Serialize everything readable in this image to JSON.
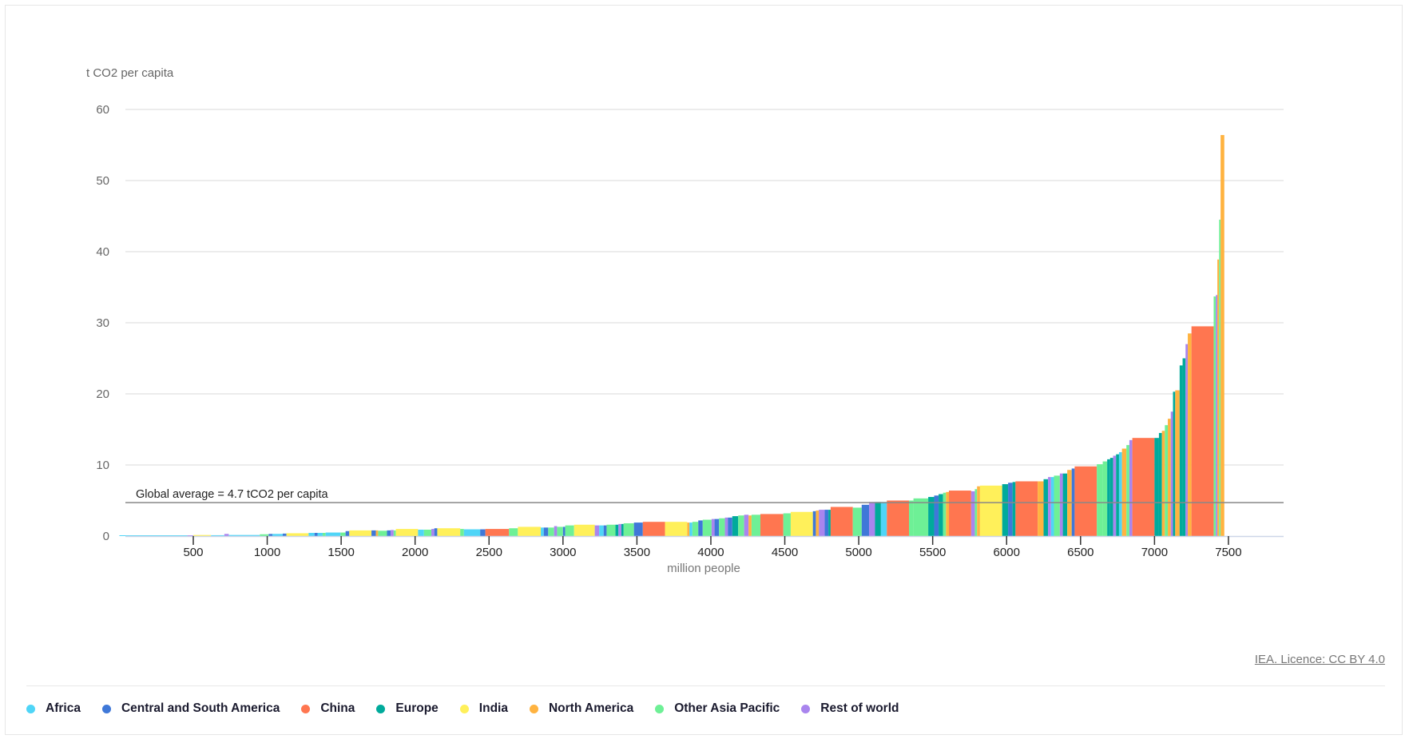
{
  "chart_data": {
    "type": "bar",
    "subtype": "variable-width (Marimekko) bar chart sorted by value",
    "title": "",
    "ylabel": "t CO2 per capita",
    "xlabel": "million people",
    "ylim": [
      0,
      60
    ],
    "xlim": [
      0,
      7830
    ],
    "yticks": [
      "0",
      "10",
      "20",
      "30",
      "40",
      "50",
      "60"
    ],
    "xticks": [
      "500",
      "1000",
      "1500",
      "2000",
      "2500",
      "3000",
      "3500",
      "4000",
      "4500",
      "5000",
      "5500",
      "6000",
      "6500",
      "7000",
      "7500"
    ],
    "grid": true,
    "reference_line": {
      "value": 4.7,
      "label": "Global average = 4.7 tCO2 per capita"
    },
    "legend_position": "bottom-left",
    "regions": [
      {
        "name": "Africa",
        "color": "#4fd5f7"
      },
      {
        "name": "Central and South America",
        "color": "#3f78d8"
      },
      {
        "name": "China",
        "color": "#ff7650"
      },
      {
        "name": "Europe",
        "color": "#00aa9b"
      },
      {
        "name": "India",
        "color": "#fff05a"
      },
      {
        "name": "North America",
        "color": "#ffb340"
      },
      {
        "name": "Other Asia Pacific",
        "color": "#6ef096"
      },
      {
        "name": "Rest of world",
        "color": "#a985ee"
      }
    ],
    "bars_columns": [
      "population_million",
      "t_co2_per_capita",
      "region"
    ],
    "bars": [
      [
        460,
        0.05,
        "Africa"
      ],
      [
        40,
        0.1,
        "Rest of world"
      ],
      [
        120,
        0.15,
        "India"
      ],
      [
        90,
        0.12,
        "Africa"
      ],
      [
        30,
        0.3,
        "Rest of world"
      ],
      [
        210,
        0.15,
        "Africa"
      ],
      [
        60,
        0.25,
        "Other Asia Pacific"
      ],
      [
        25,
        0.3,
        "Central and South America"
      ],
      [
        70,
        0.3,
        "Africa"
      ],
      [
        25,
        0.35,
        "Central and South America"
      ],
      [
        150,
        0.4,
        "India"
      ],
      [
        40,
        0.45,
        "Africa"
      ],
      [
        20,
        0.45,
        "Central and South America"
      ],
      [
        35,
        0.45,
        "Africa"
      ],
      [
        20,
        0.45,
        "Other Asia Pacific"
      ],
      [
        100,
        0.5,
        "Africa"
      ],
      [
        35,
        0.5,
        "Other Asia Pacific"
      ],
      [
        25,
        0.7,
        "Central and South America"
      ],
      [
        150,
        0.8,
        "India"
      ],
      [
        30,
        0.8,
        "Central and South America"
      ],
      [
        15,
        0.8,
        "North America"
      ],
      [
        60,
        0.75,
        "Other Asia Pacific"
      ],
      [
        25,
        0.8,
        "Central and South America"
      ],
      [
        20,
        0.85,
        "Rest of world"
      ],
      [
        15,
        0.8,
        "Other Asia Pacific"
      ],
      [
        150,
        1.0,
        "India"
      ],
      [
        40,
        0.9,
        "Africa"
      ],
      [
        50,
        0.9,
        "Other Asia Pacific"
      ],
      [
        20,
        1.0,
        "Rest of world"
      ],
      [
        20,
        1.1,
        "Central and South America"
      ],
      [
        155,
        1.1,
        "India"
      ],
      [
        25,
        1.0,
        "Other Asia Pacific"
      ],
      [
        110,
        0.95,
        "Africa"
      ],
      [
        35,
        0.95,
        "Central and South America"
      ],
      [
        160,
        1.0,
        "China"
      ],
      [
        60,
        1.1,
        "Other Asia Pacific"
      ],
      [
        155,
        1.3,
        "India"
      ],
      [
        20,
        1.2,
        "Africa"
      ],
      [
        30,
        1.2,
        "Central and South America"
      ],
      [
        40,
        1.2,
        "Other Asia Pacific"
      ],
      [
        20,
        1.4,
        "Rest of world"
      ],
      [
        40,
        1.3,
        "Other Asia Pacific"
      ],
      [
        15,
        1.3,
        "Central and South America"
      ],
      [
        60,
        1.5,
        "Other Asia Pacific"
      ],
      [
        140,
        1.6,
        "India"
      ],
      [
        30,
        1.5,
        "Rest of world"
      ],
      [
        30,
        1.5,
        "Africa"
      ],
      [
        20,
        1.5,
        "Central and South America"
      ],
      [
        60,
        1.6,
        "Other Asia Pacific"
      ],
      [
        20,
        1.6,
        "Europe"
      ],
      [
        20,
        1.7,
        "Rest of world"
      ],
      [
        15,
        1.7,
        "Europe"
      ],
      [
        70,
        1.8,
        "Other Asia Pacific"
      ],
      [
        60,
        1.9,
        "Central and South America"
      ],
      [
        150,
        2.0,
        "China"
      ],
      [
        150,
        2.0,
        "India"
      ],
      [
        15,
        1.9,
        "North America"
      ],
      [
        20,
        1.9,
        "Africa"
      ],
      [
        40,
        2.0,
        "Other Asia Pacific"
      ],
      [
        30,
        2.2,
        "Central and South America"
      ],
      [
        60,
        2.3,
        "Other Asia Pacific"
      ],
      [
        20,
        2.4,
        "Rest of world"
      ],
      [
        30,
        2.4,
        "Central and South America"
      ],
      [
        40,
        2.5,
        "Other Asia Pacific"
      ],
      [
        20,
        2.6,
        "Rest of world"
      ],
      [
        30,
        2.6,
        "Central and South America"
      ],
      [
        40,
        2.8,
        "Europe"
      ],
      [
        40,
        2.9,
        "Other Asia Pacific"
      ],
      [
        30,
        3.0,
        "Rest of world"
      ],
      [
        20,
        2.9,
        "North America"
      ],
      [
        60,
        3.0,
        "Other Asia Pacific"
      ],
      [
        155,
        3.1,
        "China"
      ],
      [
        50,
        3.2,
        "Other Asia Pacific"
      ],
      [
        150,
        3.4,
        "India"
      ],
      [
        20,
        3.5,
        "Central and South America"
      ],
      [
        20,
        3.6,
        "North America"
      ],
      [
        40,
        3.7,
        "Rest of world"
      ],
      [
        25,
        3.7,
        "Central and South America"
      ],
      [
        15,
        3.7,
        "Europe"
      ],
      [
        150,
        4.1,
        "China"
      ],
      [
        60,
        4.0,
        "Other Asia Pacific"
      ],
      [
        50,
        4.4,
        "Central and South America"
      ],
      [
        40,
        4.8,
        "Rest of world"
      ],
      [
        40,
        4.8,
        "Europe"
      ],
      [
        40,
        4.8,
        "Africa"
      ],
      [
        150,
        5.0,
        "China"
      ],
      [
        30,
        5.0,
        "Other Asia Pacific"
      ],
      [
        100,
        5.3,
        "Other Asia Pacific"
      ],
      [
        40,
        5.5,
        "Europe"
      ],
      [
        30,
        5.7,
        "Central and South America"
      ],
      [
        30,
        5.9,
        "Europe"
      ],
      [
        20,
        6.1,
        "Other Asia Pacific"
      ],
      [
        20,
        6.2,
        "North America"
      ],
      [
        150,
        6.4,
        "China"
      ],
      [
        25,
        6.3,
        "Rest of world"
      ],
      [
        15,
        6.6,
        "Other Asia Pacific"
      ],
      [
        20,
        7.0,
        "North America"
      ],
      [
        150,
        7.1,
        "India"
      ],
      [
        40,
        7.3,
        "Europe"
      ],
      [
        30,
        7.5,
        "Central and South America"
      ],
      [
        20,
        7.6,
        "Europe"
      ],
      [
        150,
        7.7,
        "China"
      ],
      [
        40,
        7.7,
        "North America"
      ],
      [
        30,
        8.0,
        "Europe"
      ],
      [
        20,
        8.3,
        "Rest of world"
      ],
      [
        20,
        8.3,
        "Africa"
      ],
      [
        40,
        8.5,
        "Other Asia Pacific"
      ],
      [
        20,
        8.8,
        "Rest of world"
      ],
      [
        30,
        8.8,
        "Europe"
      ],
      [
        30,
        9.3,
        "North America"
      ],
      [
        20,
        9.5,
        "Central and South America"
      ],
      [
        150,
        9.8,
        "China"
      ],
      [
        40,
        10.1,
        "Other Asia Pacific"
      ],
      [
        30,
        10.5,
        "Other Asia Pacific"
      ],
      [
        20,
        10.8,
        "Europe"
      ],
      [
        20,
        11.0,
        "Europe"
      ],
      [
        20,
        11.3,
        "Rest of world"
      ],
      [
        20,
        11.5,
        "Europe"
      ],
      [
        20,
        11.8,
        "Africa"
      ],
      [
        30,
        12.3,
        "North America"
      ],
      [
        20,
        12.8,
        "Other Asia Pacific"
      ],
      [
        20,
        13.5,
        "Rest of world"
      ],
      [
        150,
        13.8,
        "China"
      ],
      [
        30,
        13.8,
        "Europe"
      ],
      [
        20,
        14.5,
        "Europe"
      ],
      [
        20,
        14.8,
        "North America"
      ],
      [
        20,
        15.6,
        "Other Asia Pacific"
      ],
      [
        20,
        16.5,
        "North America"
      ],
      [
        15,
        17.5,
        "Rest of world"
      ],
      [
        15,
        20.3,
        "Europe"
      ],
      [
        30,
        20.5,
        "North America"
      ],
      [
        20,
        24.0,
        "Europe"
      ],
      [
        20,
        25.0,
        "Europe"
      ],
      [
        15,
        27.0,
        "Rest of world"
      ],
      [
        25,
        28.5,
        "North America"
      ],
      [
        150,
        29.5,
        "China"
      ],
      [
        15,
        33.7,
        "Other Asia Pacific"
      ],
      [
        10,
        33.9,
        "Rest of world"
      ],
      [
        12,
        38.9,
        "North America"
      ],
      [
        10,
        44.5,
        "Other Asia Pacific"
      ],
      [
        25,
        56.4,
        "North America"
      ]
    ]
  },
  "footer": {
    "license_label": "IEA. Licence: CC BY 4.0"
  },
  "legend": {
    "items": [
      {
        "label": "Africa",
        "color": "#4fd5f7"
      },
      {
        "label": "Central and South America",
        "color": "#3f78d8"
      },
      {
        "label": "China",
        "color": "#ff7650"
      },
      {
        "label": "Europe",
        "color": "#00aa9b"
      },
      {
        "label": "India",
        "color": "#fff05a"
      },
      {
        "label": "North America",
        "color": "#ffb340"
      },
      {
        "label": "Other Asia Pacific",
        "color": "#6ef096"
      },
      {
        "label": "Rest of world",
        "color": "#a985ee"
      }
    ]
  }
}
